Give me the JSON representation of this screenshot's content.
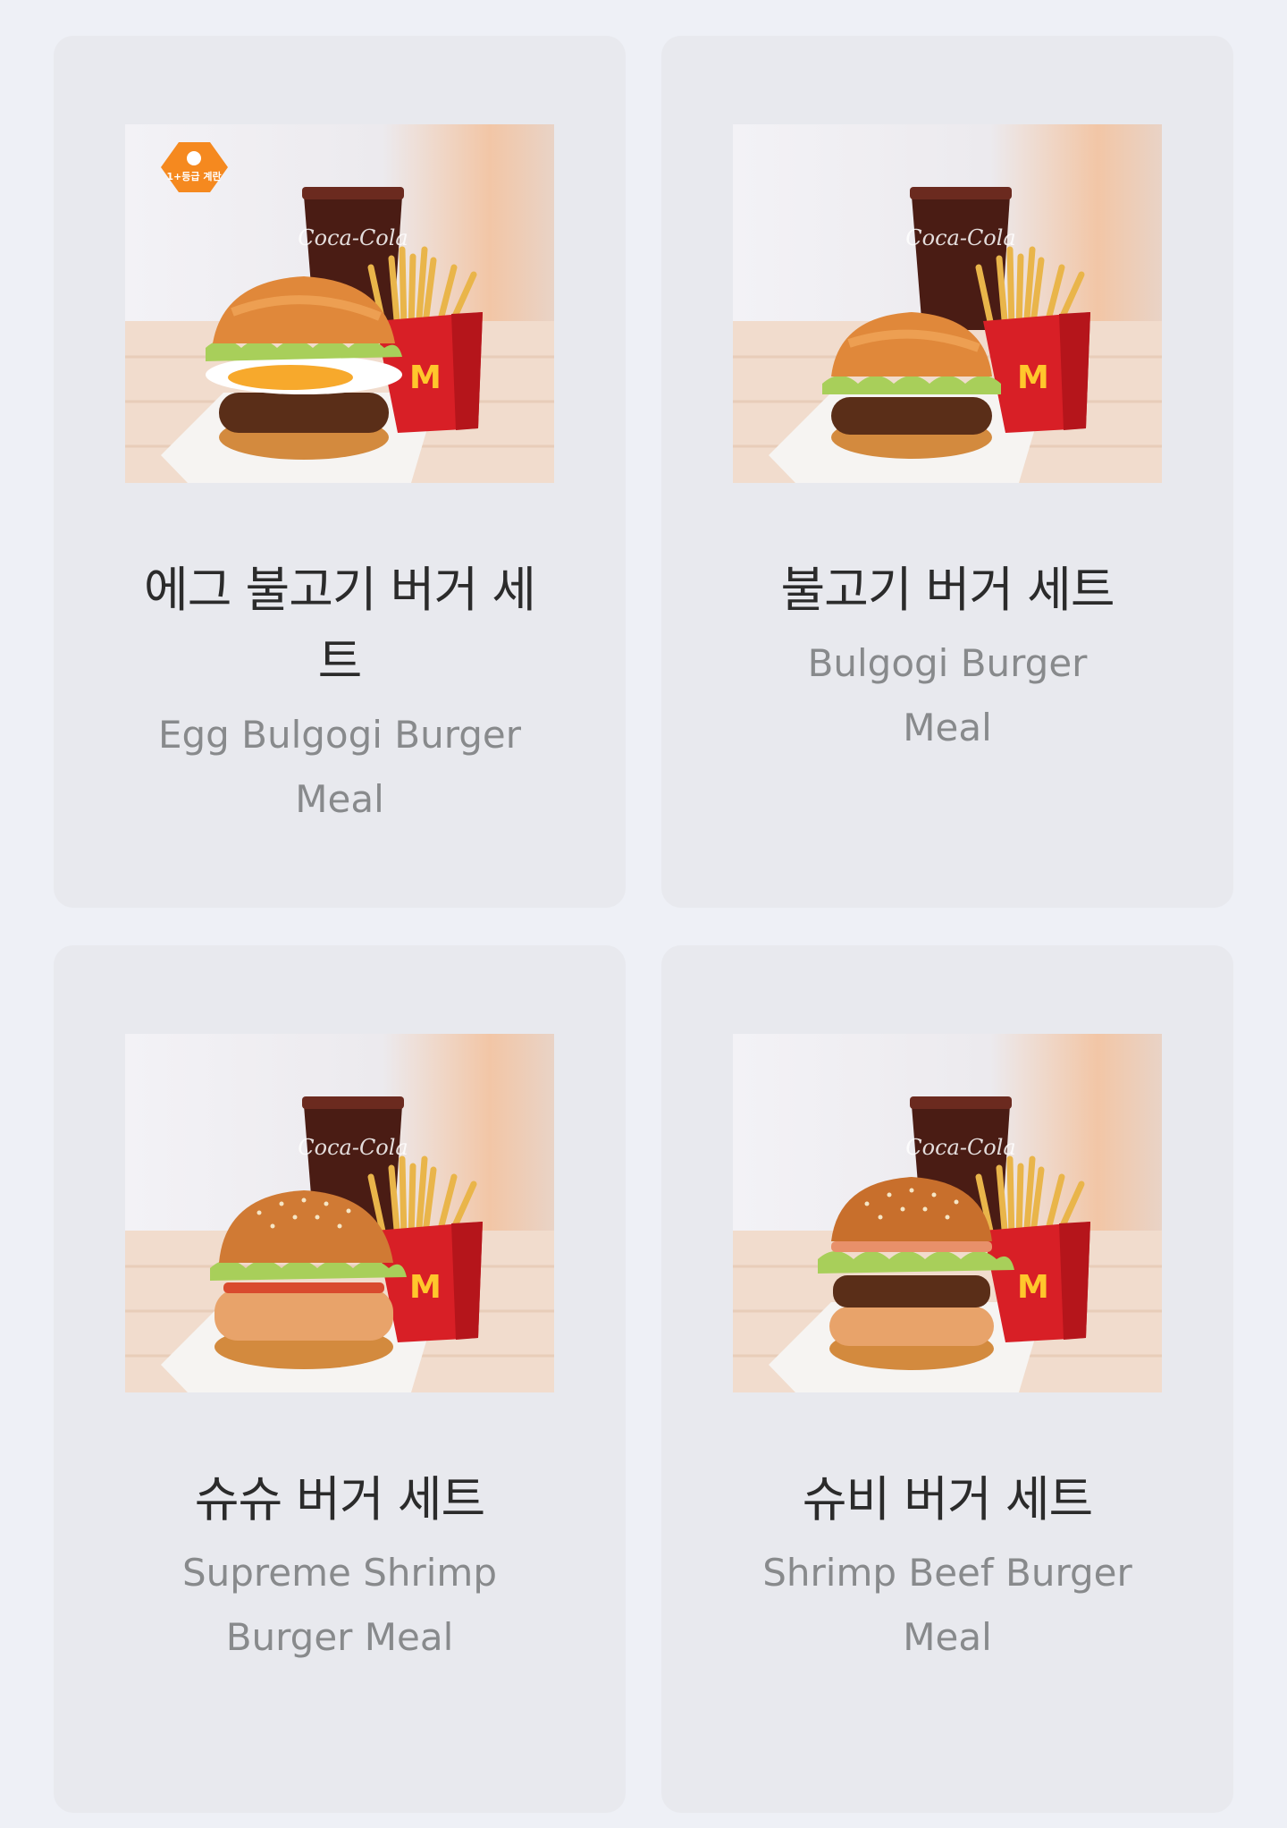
{
  "menu": {
    "items": [
      {
        "name_ko": "에그 불고기 버거 세트",
        "name_en": "Egg Bulgogi Burger Meal",
        "badge_label": "1+등급 계란",
        "cup_label": "Coca-Cola",
        "burger": "egg-bulgogi"
      },
      {
        "name_ko": "불고기 버거 세트",
        "name_en": "Bulgogi Burger Meal",
        "cup_label": "Coca-Cola",
        "burger": "bulgogi"
      },
      {
        "name_ko": "슈슈 버거 세트",
        "name_en": "Supreme Shrimp Burger Meal",
        "cup_label": "Coca-Cola",
        "burger": "shrimp"
      },
      {
        "name_ko": "슈비 버거 세트",
        "name_en": "Shrimp Beef Burger Meal",
        "cup_label": "Coca-Cola",
        "burger": "shrimp-beef"
      }
    ]
  },
  "colors": {
    "page_bg": "#eef0f6",
    "card_bg": "#e8e9ee",
    "name_ko": "#2b2b2b",
    "name_en": "#888a8c",
    "badge": "#f5891f",
    "fries_box": "#d81f26"
  }
}
